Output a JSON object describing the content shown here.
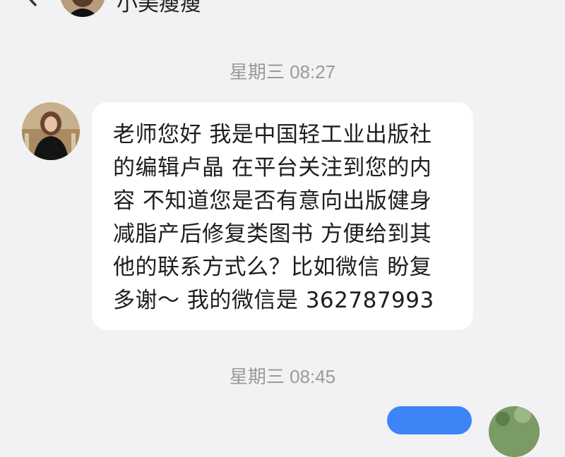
{
  "header": {
    "title": "小美瘦瘦",
    "back_icon": "chevron-left-icon"
  },
  "messages": [
    {
      "timestamp": "星期三 08:27",
      "text": "老师您好 我是中国轻工业出版社的编辑卢晶 在平台关注到您的内容 不知道您是否有意向出版健身减脂产后修复类图书 方便给到其他的联系方式么？比如微信 盼复多谢～ 我的微信是 362787993"
    },
    {
      "timestamp": "星期三 08:45"
    }
  ],
  "colors": {
    "background": "#f2f2f4",
    "bubble_incoming": "#ffffff",
    "bubble_outgoing": "#3d84f6",
    "timestamp": "#9a9a9a",
    "text": "#1e1e1e"
  }
}
